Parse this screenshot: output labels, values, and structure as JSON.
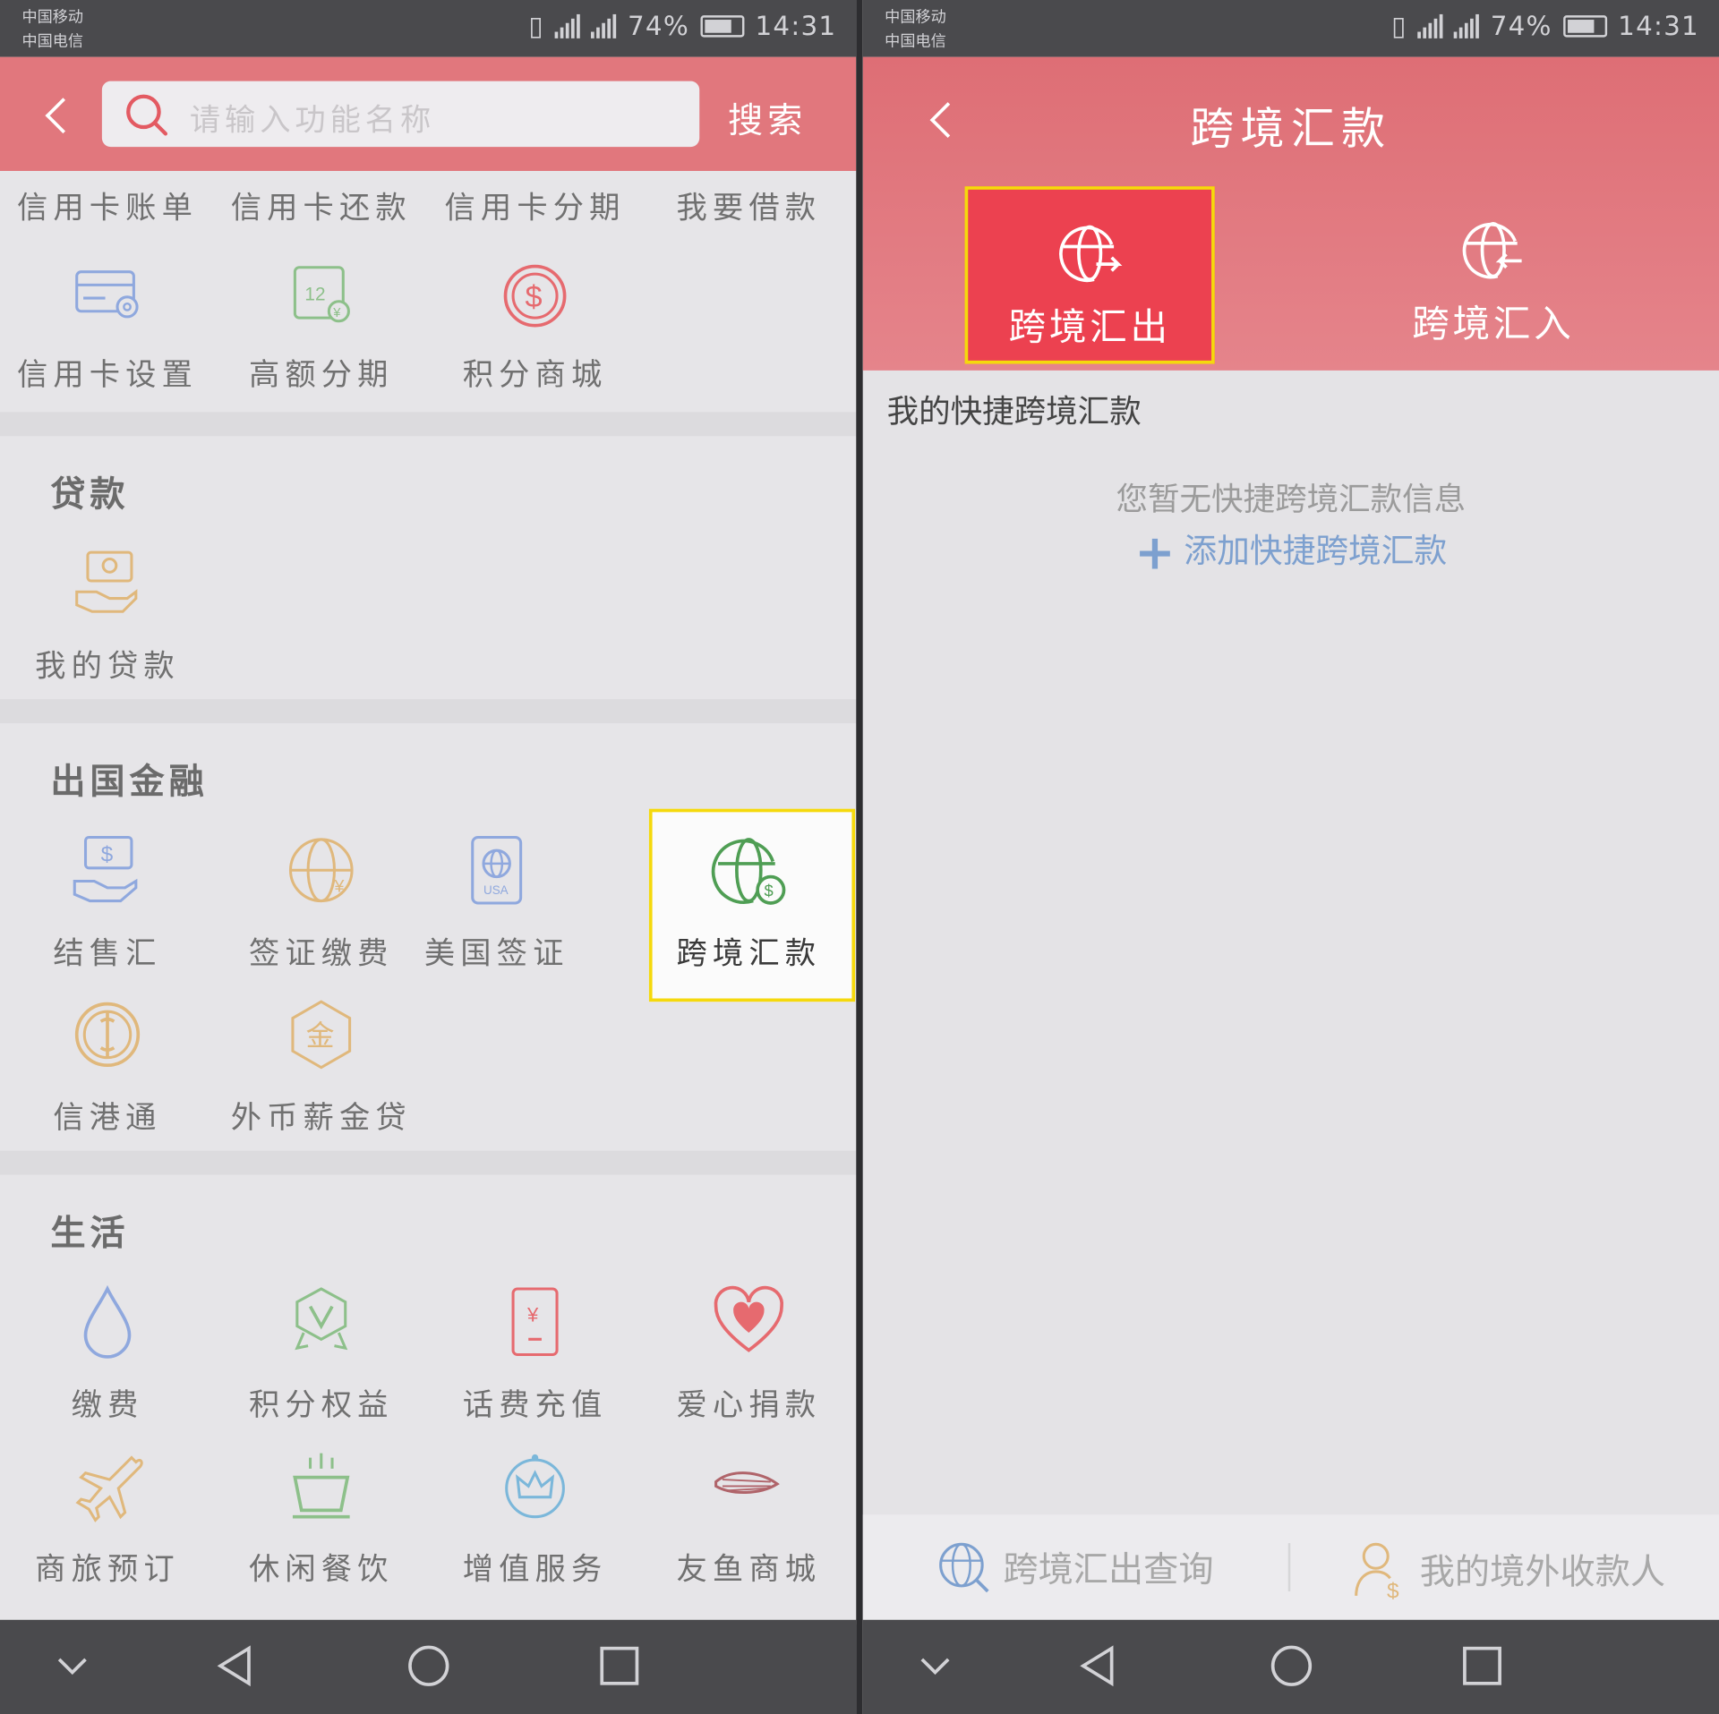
{
  "status": {
    "carrier1": "中国移动",
    "carrier2": "中国电信",
    "battery": "74%",
    "time": "14:31",
    "net1": "2G",
    "net2": "4G",
    "net3": "2G"
  },
  "left": {
    "search": {
      "placeholder": "请输入功能名称",
      "button": "搜索"
    },
    "top_row": [
      "信用卡账单",
      "信用卡还款",
      "信用卡分期",
      "我要借款"
    ],
    "card_row": [
      {
        "label": "信用卡设置",
        "icon": "card-settings-icon"
      },
      {
        "label": "高额分期",
        "icon": "installment-12-icon"
      },
      {
        "label": "积分商城",
        "icon": "dollar-coin-icon"
      }
    ],
    "loan": {
      "title": "贷款",
      "items": [
        {
          "label": "我的贷款",
          "icon": "loan-hand-icon"
        }
      ]
    },
    "overseas": {
      "title": "出国金融",
      "items": [
        {
          "label": "结售汇",
          "icon": "exchange-hand-icon"
        },
        {
          "label": "签证缴费",
          "icon": "globe-yen-icon"
        },
        {
          "label": "美国签证",
          "icon": "usa-passport-icon",
          "badge": "USA"
        },
        {
          "label": "跨境汇款",
          "icon": "globe-dollar-icon"
        },
        {
          "label": "信港通",
          "icon": "globe-coin-icon"
        },
        {
          "label": "外币薪金贷",
          "icon": "gold-hexagon-icon",
          "badge": "金"
        }
      ]
    },
    "life": {
      "title": "生活",
      "items": [
        {
          "label": "缴费",
          "icon": "water-drop-icon"
        },
        {
          "label": "积分权益",
          "icon": "badge-v-icon"
        },
        {
          "label": "话费充值",
          "icon": "phone-yen-icon"
        },
        {
          "label": "爱心捐款",
          "icon": "heart-icon"
        },
        {
          "label": "商旅预订",
          "icon": "airplane-icon"
        },
        {
          "label": "休闲餐饮",
          "icon": "cup-icon"
        },
        {
          "label": "增值服务",
          "icon": "crown-icon"
        },
        {
          "label": "友鱼商城",
          "icon": "fish-icon"
        }
      ]
    }
  },
  "right": {
    "title": "跨境汇款",
    "tabs": [
      {
        "label": "跨境汇出",
        "active": true
      },
      {
        "label": "跨境汇入",
        "active": false
      }
    ],
    "quick_title": "我的快捷跨境汇款",
    "empty_message": "您暂无快捷跨境汇款信息",
    "add_link": "添加快捷跨境汇款",
    "bottom": [
      {
        "label": "跨境汇出查询",
        "icon": "globe-search-icon"
      },
      {
        "label": "我的境外收款人",
        "icon": "payee-icon"
      }
    ]
  },
  "colors": {
    "header": "#e1777d",
    "active_tab": "#ec4150",
    "highlight": "#f5d90c",
    "link": "#7da0cf"
  }
}
